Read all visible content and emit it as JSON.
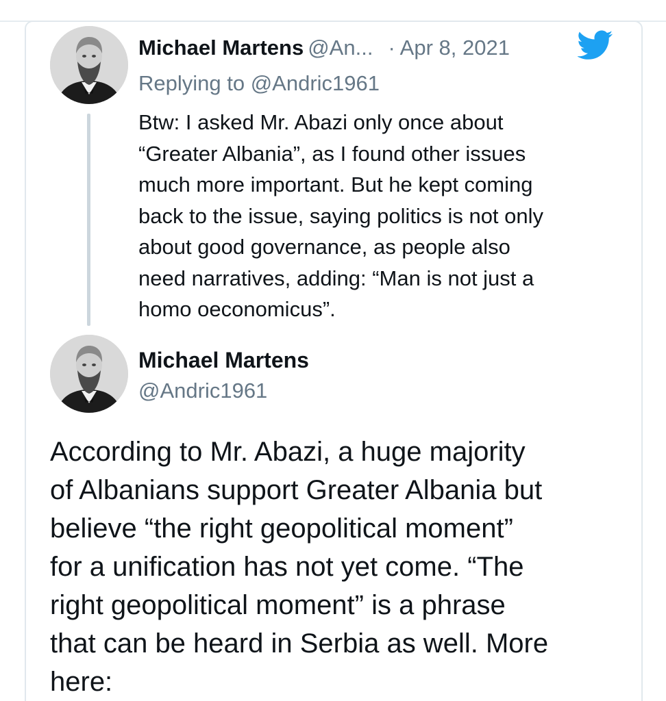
{
  "colors": {
    "text_primary": "#0f1419",
    "text_secondary": "#657786",
    "twitter_blue": "#1da1f2",
    "thread_line": "#ccd6dd",
    "card_border": "#e1e8ed"
  },
  "reply_tweet": {
    "author_name": "Michael Martens",
    "author_handle": "@An...",
    "date": "· Apr 8, 2021",
    "replying_to": "Replying to @Andric1961",
    "text": "Btw: I asked Mr. Abazi only once about\n“Greater Albania”, as I found other issues\nmuch more important. But he kept coming\nback to the issue, saying politics is not only\nabout good governance, as people also\nneed narratives, adding:  “Man is not just a\nhomo oeconomicus”.",
    "avatar_icon": "profile-photo-icon",
    "logo_icon": "twitter-bird-icon"
  },
  "main_tweet": {
    "author_name": "Michael Martens",
    "author_handle": "@Andric1961",
    "text": "According to Mr. Abazi, a huge majority\nof Albanians support Greater Albania but\nbelieve “the right geopolitical moment”\nfor a unification has not yet come. “The\nright geopolitical moment” is a phrase\nthat can be heard in Serbia as well. More\nhere:",
    "avatar_icon": "profile-photo-icon"
  }
}
